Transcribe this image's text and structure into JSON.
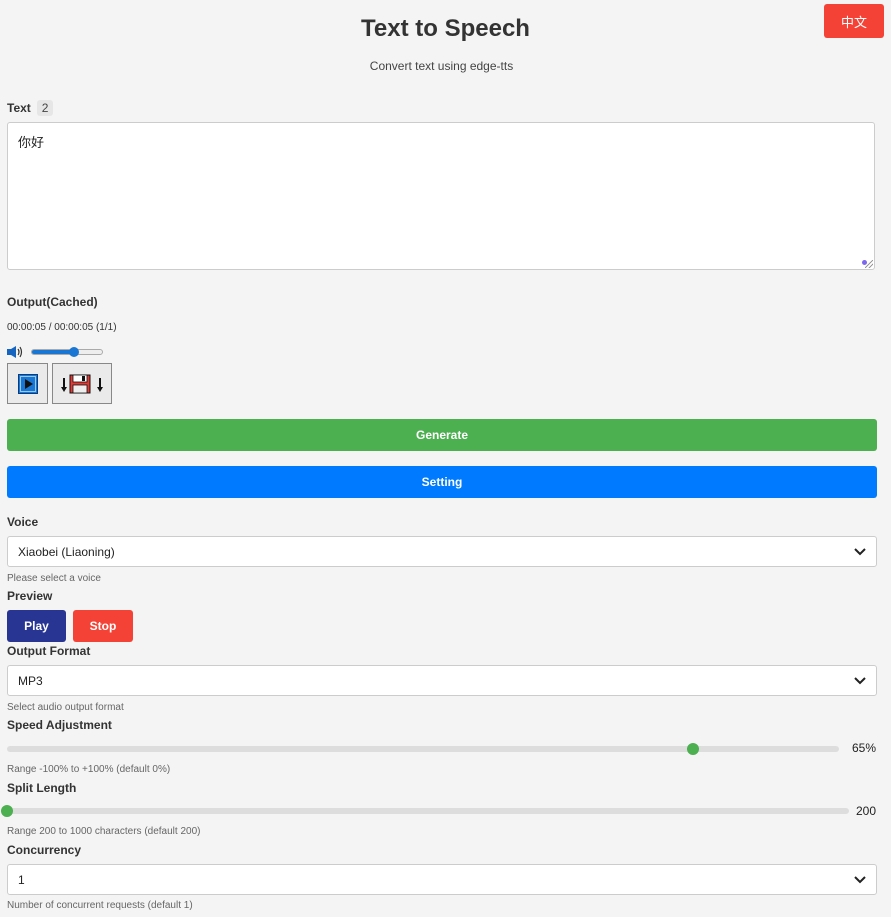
{
  "header": {
    "title": "Text to Speech",
    "subtitle": "Convert text using edge-tts",
    "lang_button": "中文"
  },
  "text": {
    "label": "Text",
    "count": "2",
    "value": "你好"
  },
  "output": {
    "label": "Output(Cached)",
    "time": "00:00:05 / 00:00:05 (1/1)",
    "volume": 0.6,
    "play_icon": "play-icon",
    "save_icon": "save-download-icon"
  },
  "actions": {
    "generate": "Generate",
    "setting": "Setting"
  },
  "voice": {
    "label": "Voice",
    "selected": "Xiaobei (Liaoning)",
    "hint": "Please select a voice"
  },
  "preview": {
    "label": "Preview",
    "play": "Play",
    "stop": "Stop"
  },
  "format": {
    "label": "Output Format",
    "selected": "MP3",
    "hint": "Select audio output format"
  },
  "speed": {
    "label": "Speed Adjustment",
    "value_text": "65%",
    "value": 65,
    "min": -100,
    "max": 100,
    "hint": "Range -100% to +100% (default 0%)"
  },
  "split": {
    "label": "Split Length",
    "value_text": "200",
    "value": 200,
    "min": 200,
    "max": 1000,
    "hint": "Range 200 to 1000 characters (default 200)"
  },
  "concurrency": {
    "label": "Concurrency",
    "selected": "1",
    "hint": "Number of concurrent requests (default 1)"
  },
  "colors": {
    "generate": "#4caf50",
    "setting": "#007bff",
    "stop": "#f44336",
    "play": "#283593"
  }
}
